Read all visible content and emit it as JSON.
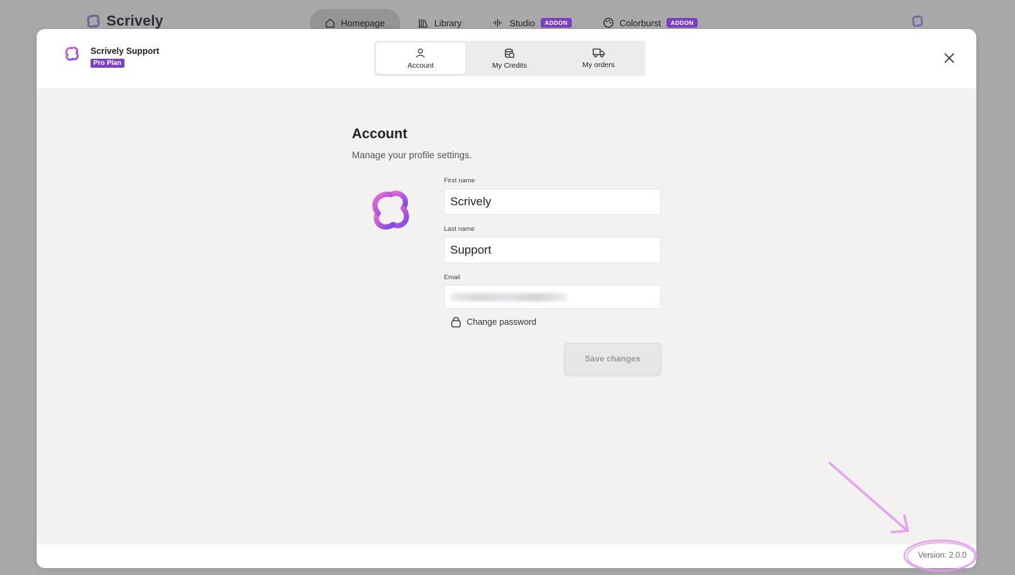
{
  "background_nav": {
    "logo_text": "Scrively",
    "tabs": [
      {
        "label": "Homepage",
        "icon": "home-icon"
      },
      {
        "label": "Library",
        "icon": "library-icon"
      },
      {
        "label": "Studio",
        "icon": "audio-wave-icon",
        "badge": "ADDON"
      },
      {
        "label": "Colorburst",
        "icon": "palette-icon",
        "badge": "ADDON"
      }
    ]
  },
  "modal": {
    "user_name": "Scrively Support",
    "plan_badge": "Pro Plan",
    "tabs": [
      {
        "label": "Account",
        "icon": "user-icon",
        "active": true
      },
      {
        "label": "My Credits",
        "icon": "coins-icon",
        "active": false
      },
      {
        "label": "My orders",
        "icon": "truck-icon",
        "active": false
      }
    ],
    "account": {
      "title": "Account",
      "subtitle": "Manage your profile settings.",
      "first_name_label": "First name",
      "first_name": "Scrively",
      "last_name_label": "Last name",
      "last_name": "Support",
      "email_label": "Email",
      "change_password_label": "Change password",
      "save_button_label": "Save changes"
    },
    "footer": {
      "version": "Version: 2.0.0"
    }
  },
  "colors": {
    "accent_purple": "#7b3fc6",
    "annotation_pink": "#e39af0",
    "modal_bg": "#f3f2f1",
    "overlay_bg": "#a9a9a9"
  }
}
